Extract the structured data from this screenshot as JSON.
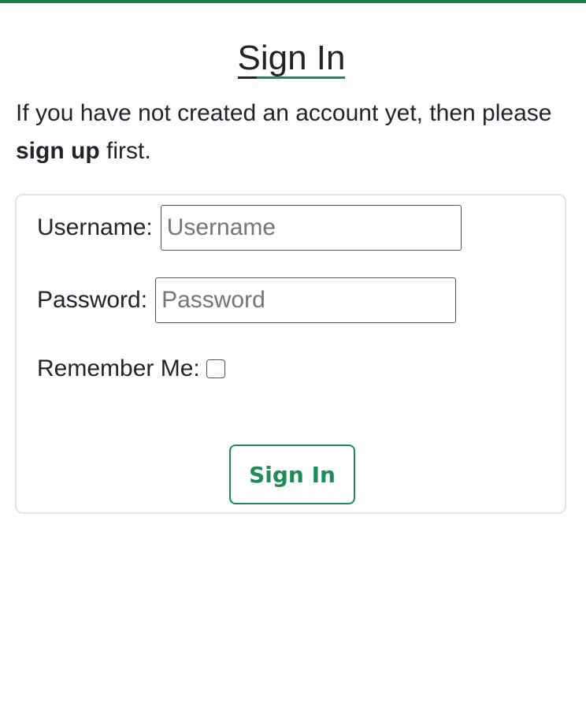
{
  "page": {
    "title": "Sign In",
    "intro_text_before": "If you have not created an account yet, then please ",
    "intro_link": "sign up",
    "intro_text_after": " first."
  },
  "form": {
    "username_label": "Username:",
    "username_placeholder": "Username",
    "username_value": "",
    "password_label": "Password:",
    "password_placeholder": "Password",
    "password_value": "",
    "remember_label": "Remember Me:",
    "remember_checked": false,
    "submit_label": "Sign In"
  },
  "colors": {
    "accent": "#1f8a5a",
    "top_bar": "#1e7e4a",
    "text": "#212529",
    "card_border": "#e3e3e3"
  }
}
